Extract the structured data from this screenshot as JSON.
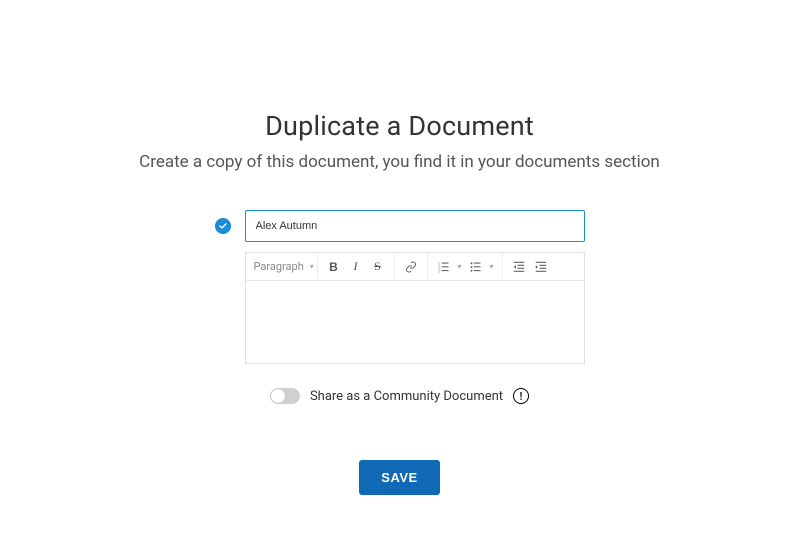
{
  "header": {
    "title": "Duplicate a Document",
    "subtitle": "Create a copy of this document, you find it in your documents section"
  },
  "form": {
    "title_value": "Alex Autumn",
    "format_label": "Paragraph"
  },
  "share": {
    "label": "Share as a Community Document",
    "toggle_on": false
  },
  "actions": {
    "save_label": "SAVE"
  },
  "icons": {
    "check": "check-icon",
    "info": "info-icon",
    "bold": "B",
    "italic": "I",
    "strike": "S"
  }
}
